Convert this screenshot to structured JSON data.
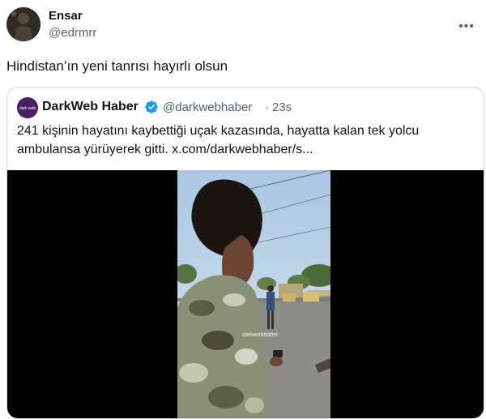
{
  "tweet": {
    "author_name": "Ensar",
    "author_handle": "@edrmrr",
    "text": "Hindistan’ın yeni tanrısı hayırlı olsun",
    "more_icon": "more-dots-icon"
  },
  "quoted_tweet": {
    "author_name": "DarkWeb Haber",
    "verified": true,
    "author_handle": "@darkwebhaber",
    "separator": "·",
    "time": "23s",
    "text_line1": "241 kişinin hayatını kaybettiği uçak kazasında, hayatta kalan tek yolcu",
    "text_line2": "ambulansa yürüyerek gitti.  x.com/darkwebhaber/s...",
    "avatar_text": "dark web",
    "video_watermark": "darkwebhaber"
  },
  "colors": {
    "text": "#0f1419",
    "secondary": "#536471",
    "verified": "#1d9bf0",
    "border": "#cfd9de"
  }
}
